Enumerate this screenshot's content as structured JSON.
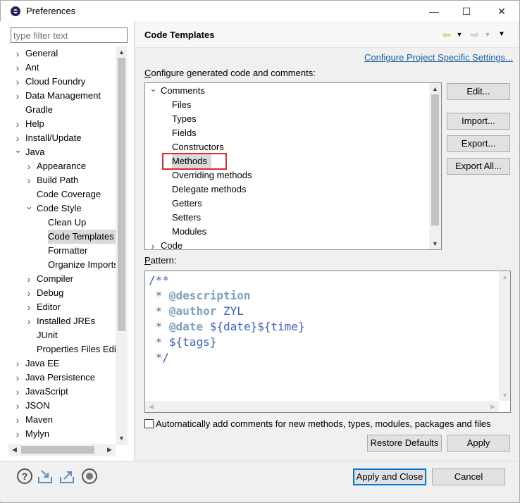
{
  "window": {
    "title": "Preferences",
    "controls": [
      "—",
      "☐",
      "✕"
    ]
  },
  "filter": {
    "placeholder": "type filter text"
  },
  "nav_tree": [
    {
      "label": "General",
      "level": 0,
      "expander": "collapsed"
    },
    {
      "label": "Ant",
      "level": 0,
      "expander": "collapsed"
    },
    {
      "label": "Cloud Foundry",
      "level": 0,
      "expander": "collapsed"
    },
    {
      "label": "Data Management",
      "level": 0,
      "expander": "collapsed"
    },
    {
      "label": "Gradle",
      "level": 0,
      "expander": "none"
    },
    {
      "label": "Help",
      "level": 0,
      "expander": "collapsed"
    },
    {
      "label": "Install/Update",
      "level": 0,
      "expander": "collapsed"
    },
    {
      "label": "Java",
      "level": 0,
      "expander": "expanded"
    },
    {
      "label": "Appearance",
      "level": 1,
      "expander": "collapsed"
    },
    {
      "label": "Build Path",
      "level": 1,
      "expander": "collapsed"
    },
    {
      "label": "Code Coverage",
      "level": 1,
      "expander": "none"
    },
    {
      "label": "Code Style",
      "level": 1,
      "expander": "expanded"
    },
    {
      "label": "Clean Up",
      "level": 2,
      "expander": "none"
    },
    {
      "label": "Code Templates",
      "level": 2,
      "expander": "none",
      "selected": true
    },
    {
      "label": "Formatter",
      "level": 2,
      "expander": "none"
    },
    {
      "label": "Organize Imports",
      "level": 2,
      "expander": "none"
    },
    {
      "label": "Compiler",
      "level": 1,
      "expander": "collapsed"
    },
    {
      "label": "Debug",
      "level": 1,
      "expander": "collapsed"
    },
    {
      "label": "Editor",
      "level": 1,
      "expander": "collapsed"
    },
    {
      "label": "Installed JREs",
      "level": 1,
      "expander": "collapsed"
    },
    {
      "label": "JUnit",
      "level": 1,
      "expander": "none"
    },
    {
      "label": "Properties Files Editor",
      "level": 1,
      "expander": "none"
    },
    {
      "label": "Java EE",
      "level": 0,
      "expander": "collapsed"
    },
    {
      "label": "Java Persistence",
      "level": 0,
      "expander": "collapsed"
    },
    {
      "label": "JavaScript",
      "level": 0,
      "expander": "collapsed"
    },
    {
      "label": "JSON",
      "level": 0,
      "expander": "collapsed"
    },
    {
      "label": "Maven",
      "level": 0,
      "expander": "collapsed"
    },
    {
      "label": "Mylyn",
      "level": 0,
      "expander": "collapsed"
    }
  ],
  "page": {
    "title": "Code Templates",
    "configure_link": "Configure Project Specific Settings...",
    "configure_label_prefix": "C",
    "configure_label_rest": "onfigure generated code and comments:",
    "pattern_label_prefix": "P",
    "pattern_label_rest": "attern:",
    "checkbox_label": "Automatically add comments for new methods, types, modules, packages and files"
  },
  "template_tree": [
    {
      "label": "Comments",
      "level": 0,
      "expander": "expanded"
    },
    {
      "label": "Files",
      "level": 1
    },
    {
      "label": "Types",
      "level": 1
    },
    {
      "label": "Fields",
      "level": 1
    },
    {
      "label": "Constructors",
      "level": 1
    },
    {
      "label": "Methods",
      "level": 1,
      "selected": true
    },
    {
      "label": "Overriding methods",
      "level": 1
    },
    {
      "label": "Delegate methods",
      "level": 1
    },
    {
      "label": "Getters",
      "level": 1
    },
    {
      "label": "Setters",
      "level": 1
    },
    {
      "label": "Modules",
      "level": 1
    },
    {
      "label": "Code",
      "level": 0,
      "expander": "collapsed"
    }
  ],
  "side_buttons": {
    "edit": "Edit...",
    "import": "Import...",
    "export": "Export...",
    "export_all": "Export All..."
  },
  "pattern_lines": [
    {
      "parts": [
        {
          "t": "/**",
          "c": ""
        }
      ]
    },
    {
      "parts": [
        {
          "t": " * ",
          "c": ""
        },
        {
          "t": "@description",
          "c": "tag"
        }
      ]
    },
    {
      "parts": [
        {
          "t": " * ",
          "c": ""
        },
        {
          "t": "@author",
          "c": "tag"
        },
        {
          "t": " ZYL",
          "c": ""
        }
      ]
    },
    {
      "parts": [
        {
          "t": " * ",
          "c": ""
        },
        {
          "t": "@date",
          "c": "tag"
        },
        {
          "t": " ${date}${time}",
          "c": "var"
        }
      ]
    },
    {
      "parts": [
        {
          "t": " * ",
          "c": ""
        },
        {
          "t": "${tags}",
          "c": "var"
        }
      ]
    },
    {
      "parts": [
        {
          "t": " */",
          "c": ""
        }
      ]
    }
  ],
  "buttons": {
    "restore_defaults": "Restore Defaults",
    "apply": "Apply",
    "apply_and_close": "Apply and Close",
    "cancel": "Cancel"
  },
  "icons": {
    "help": "question-mark-icon",
    "import": "import-prefs-icon",
    "export": "export-prefs-icon",
    "record": "record-icon",
    "back": "back-arrow-icon",
    "forward": "forward-arrow-icon",
    "menu": "view-menu-icon"
  },
  "colors": {
    "link": "#1a5ea8",
    "comment": "#3f5fbf",
    "javadoc_tag": "#7f9fbf",
    "highlight_box": "#e0282e",
    "primary_button_border": "#0078d7"
  }
}
